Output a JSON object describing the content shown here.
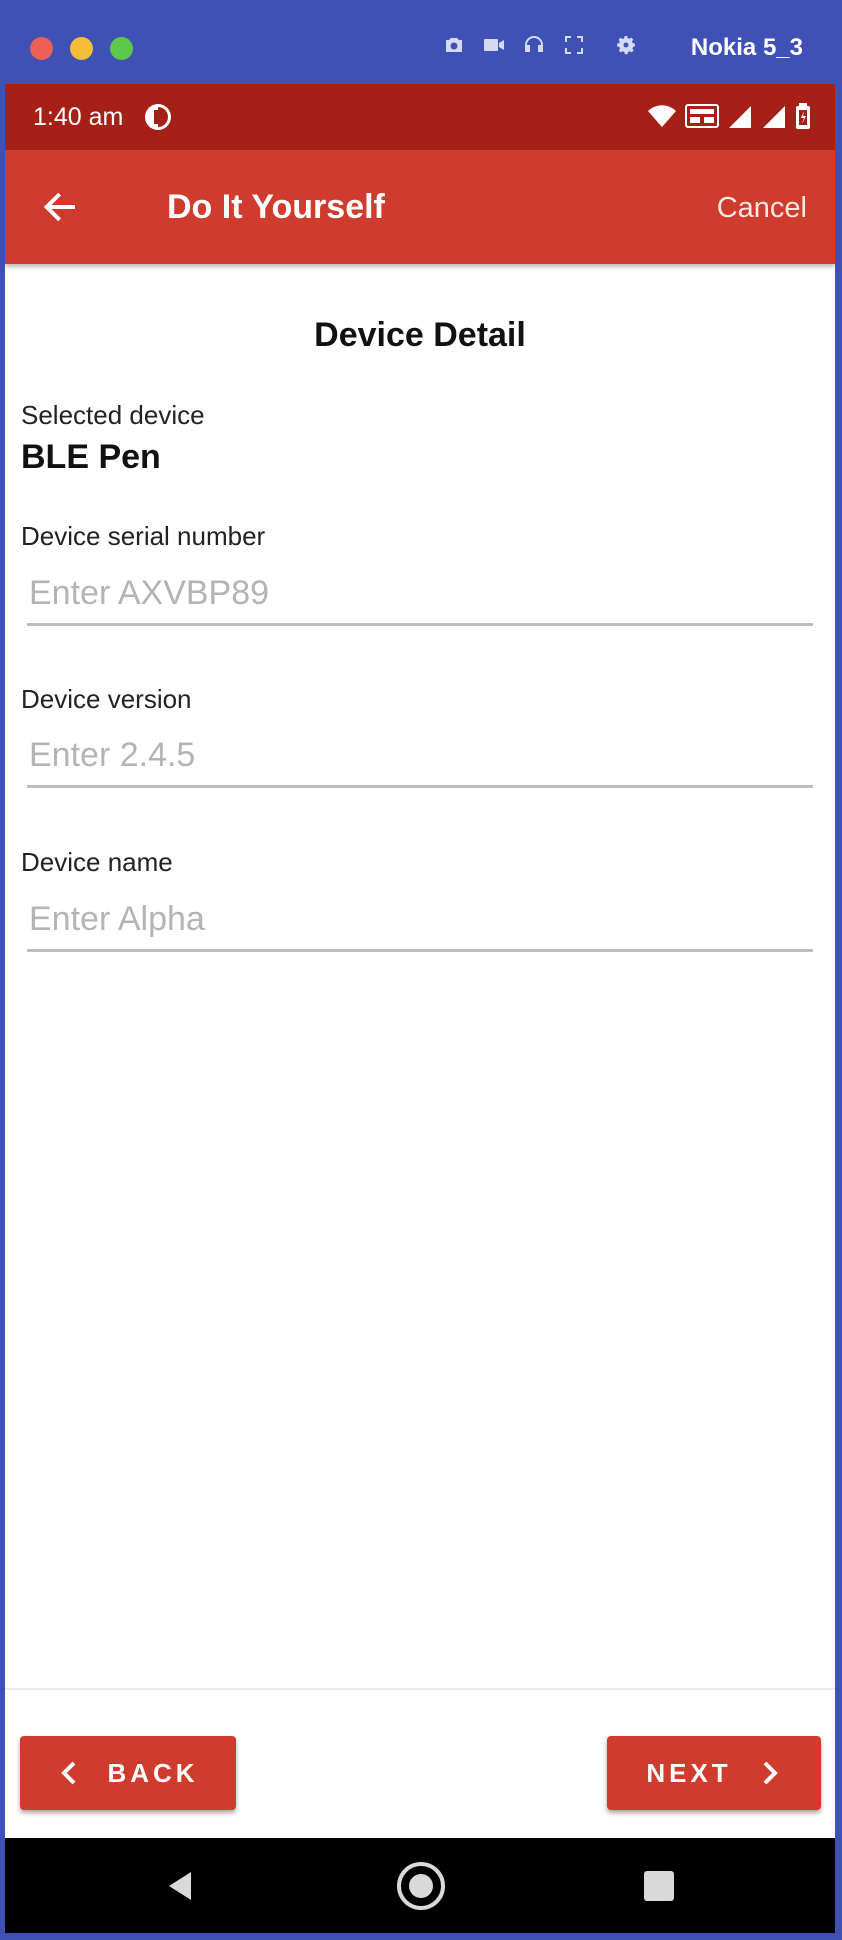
{
  "emulator": {
    "device_name": "Nokia 5_3",
    "tool_icons": [
      "camera-icon",
      "video-icon",
      "headphones-icon",
      "fullscreen-icon",
      "gear-icon"
    ]
  },
  "status_bar": {
    "time": "1:40 am",
    "icons": [
      "wifi-icon",
      "volte-icon",
      "signal-icon",
      "signal-icon",
      "battery-icon"
    ]
  },
  "app_bar": {
    "title": "Do It Yourself",
    "cancel_label": "Cancel"
  },
  "page": {
    "heading": "Device Detail",
    "selected_device_label": "Selected device",
    "selected_device_value": "BLE Pen",
    "fields": {
      "serial": {
        "label": "Device serial number",
        "value": "",
        "placeholder": "Enter AXVBP89"
      },
      "version": {
        "label": "Device version",
        "value": "",
        "placeholder": "Enter 2.4.5"
      },
      "name": {
        "label": "Device name",
        "value": "",
        "placeholder": "Enter Alpha"
      }
    }
  },
  "footer": {
    "back_label": "BACK",
    "next_label": "NEXT"
  },
  "colors": {
    "emulator_frame": "#3f51b5",
    "status_bar": "#a52118",
    "app_bar": "#cf3b2d",
    "button": "#cf3b2d"
  }
}
